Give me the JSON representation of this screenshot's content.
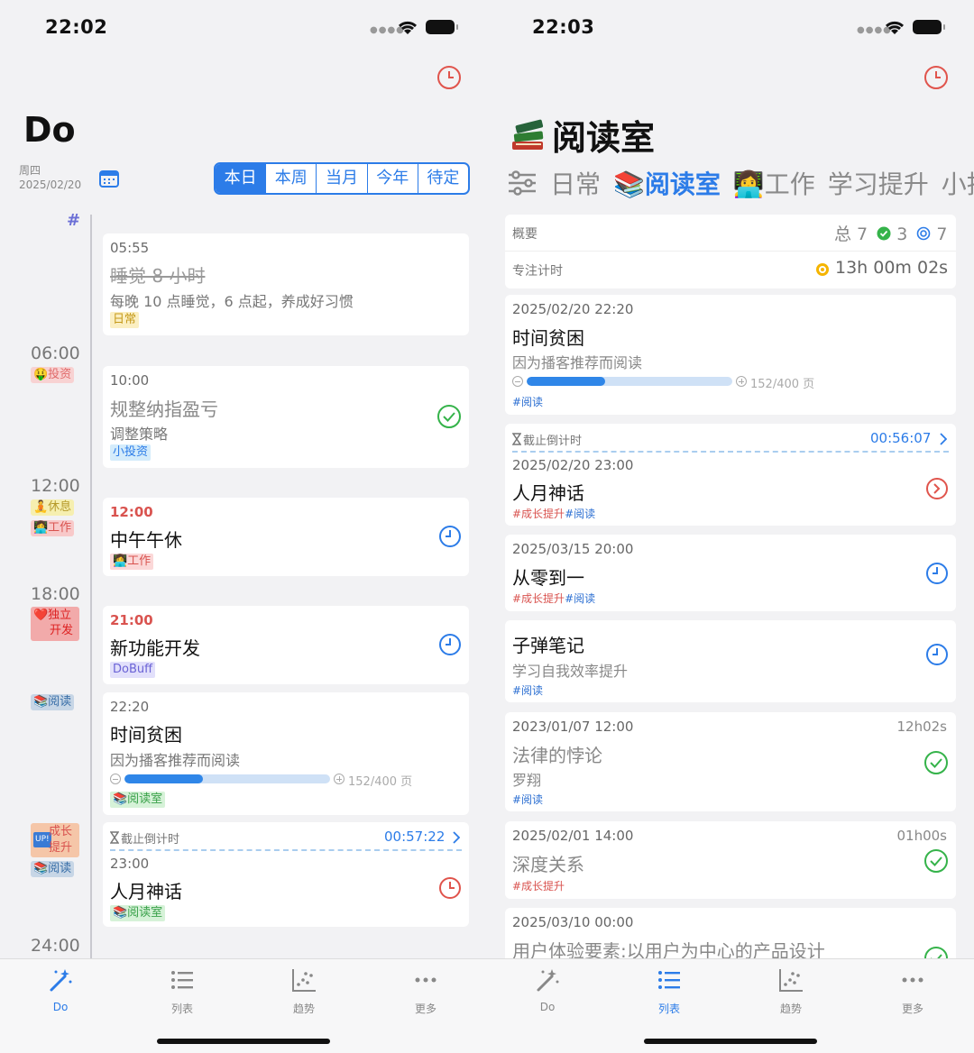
{
  "left": {
    "status_time": "22:02",
    "title": "Do",
    "weekday": "周四",
    "date": "2025/02/20",
    "segments": [
      "本日",
      "本周",
      "当月",
      "今年",
      "待定"
    ],
    "hash": "#",
    "hours": [
      "06:00",
      "12:00",
      "18:00",
      "24:00"
    ],
    "side_tags": [
      "🤑投资",
      "🧘休息",
      "👩‍💻工作",
      "❤️独立",
      "开发",
      "📚阅读",
      "成长",
      "提升",
      "📚阅读"
    ],
    "cards": [
      {
        "time": "05:55",
        "title": "睡觉 8 小时",
        "sub": "每晚 10 点睡觉，6 点起，养成好习惯",
        "tag": "日常"
      },
      {
        "time": "10:00",
        "title": "规整纳指盈亏",
        "sub": "调整策略",
        "tag": "小投资"
      },
      {
        "time": "12:00",
        "title": "中午午休",
        "tag": "👩‍💻工作"
      },
      {
        "time": "21:00",
        "title": "新功能开发",
        "tag": "DoBuff"
      },
      {
        "time": "22:20",
        "title": "时间贫困",
        "sub": "因为播客推荐而阅读",
        "progress_label": "152/400 页",
        "progress": 0.38,
        "tag": "📚阅读室"
      },
      {
        "deadline_label": "截止倒计时",
        "countdown": "00:57:22",
        "time": "23:00",
        "title": "人月神话",
        "tag": "📚阅读室"
      }
    ]
  },
  "right": {
    "status_time": "22:03",
    "title": "阅读室",
    "filters": [
      "日常",
      "📚阅读室",
      "👩‍💻工作",
      "学习提升",
      "小投"
    ],
    "summary": {
      "overview_label": "概要",
      "total_label": "总 7",
      "done_count": "3",
      "target_count": "7",
      "focus_label": "专注计时",
      "focus_time": "13h 00m 02s"
    },
    "cards": [
      {
        "date": "2025/02/20 22:20",
        "title": "时间贫困",
        "sub": "因为播客推荐而阅读",
        "progress_label": "152/400 页",
        "progress": 0.38,
        "tags": "#阅读"
      },
      {
        "deadline_label": "截止倒计时",
        "countdown": "00:56:07",
        "date": "2025/02/20 23:00",
        "title": "人月神话",
        "tag_red": "#成长提升",
        "tag_blue": "#阅读"
      },
      {
        "date": "2025/03/15 20:00",
        "title": "从零到一",
        "tag_red": "#成长提升",
        "tag_blue": "#阅读"
      },
      {
        "title": "子弹笔记",
        "sub": "学习自我效率提升",
        "tag_blue": "#阅读"
      },
      {
        "date": "2023/01/07 12:00",
        "duration": "12h02s",
        "title": "法律的悖论",
        "sub": "罗翔",
        "tag_blue": "#阅读"
      },
      {
        "date": "2025/02/01 14:00",
        "duration": "01h00s",
        "title": "深度关系",
        "tag_red": "#成长提升"
      },
      {
        "date": "2025/03/10 00:00",
        "title": "用户体验要素:以用户为中心的产品设计"
      }
    ]
  },
  "tabs": [
    "Do",
    "列表",
    "趋势",
    "更多"
  ],
  "colors": {
    "accent": "#2c7ce8",
    "red": "#e0544c",
    "green": "#35b34a"
  }
}
